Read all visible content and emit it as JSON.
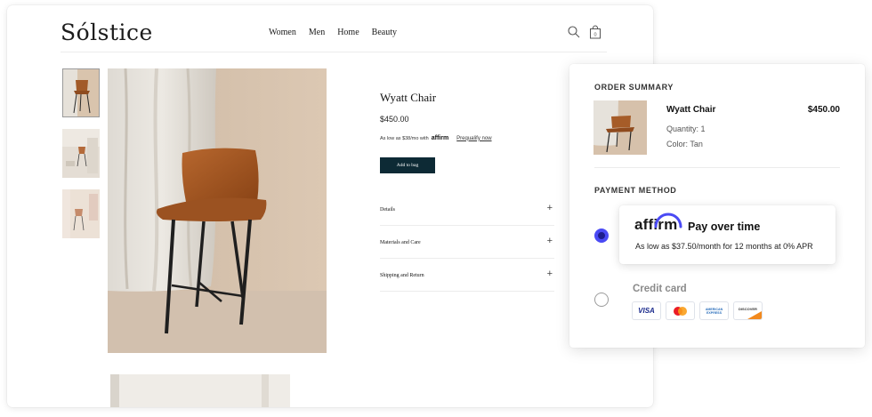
{
  "store": {
    "logo": "Sólstice",
    "nav": [
      "Women",
      "Men",
      "Home",
      "Beauty"
    ],
    "icons": {
      "search": "search-icon",
      "bag": "shopping-bag-icon"
    },
    "bag_count": "0"
  },
  "product": {
    "title": "Wyatt Chair",
    "price": "$450.00",
    "affordability_prefix": "As low as $38/mo with",
    "affordability_brand": "affirm",
    "prequalify_link": "Prequalify now",
    "add_to_bag": "Add to bag",
    "accordion": [
      {
        "label": "Details"
      },
      {
        "label": "Materials and Care"
      },
      {
        "label": "Shipping and Return"
      }
    ],
    "accordion_icon": "plus-icon"
  },
  "summary": {
    "heading": "ORDER SUMMARY",
    "item_name": "Wyatt Chair",
    "item_price": "$450.00",
    "quantity": "Quantity: 1",
    "color": "Color: Tan",
    "payment_heading": "PAYMENT METHOD",
    "affirm": {
      "logo": "affirm",
      "title": "Pay over time",
      "subtitle": "As low as $37.50/month for 12 months at 0% APR",
      "selected": true
    },
    "credit_card": {
      "label": "Credit card",
      "selected": false,
      "brands": [
        "VISA",
        "mastercard",
        "AMERICAN EXPRESS",
        "DISCOVER"
      ]
    }
  },
  "colors": {
    "add_button": "#0d2a35",
    "affirm_accent": "#4a4af4",
    "chair_leather": "#a25a28",
    "backdrop": "#d8c3ad"
  }
}
